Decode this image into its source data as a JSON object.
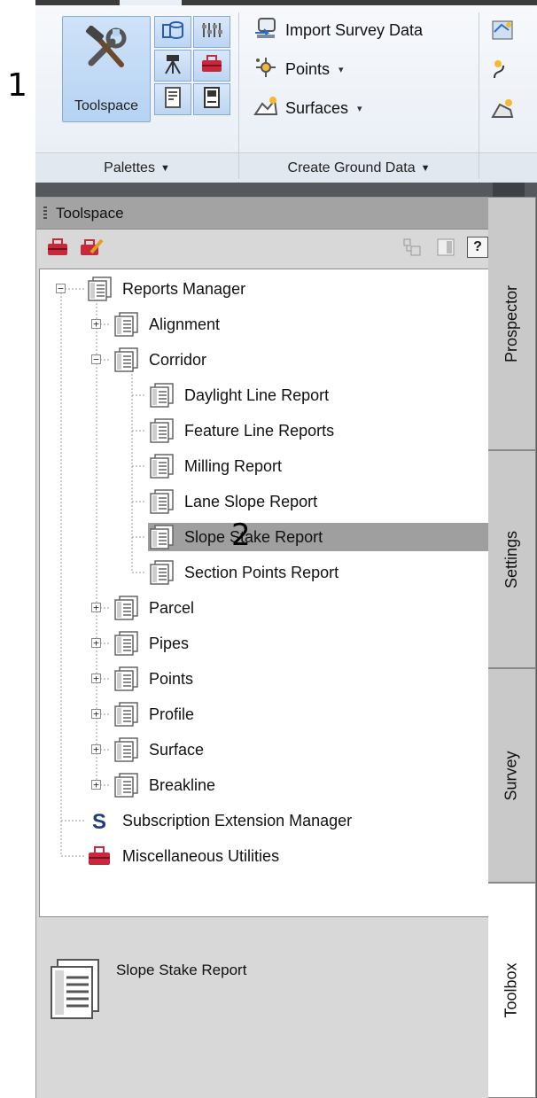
{
  "annotations": {
    "step1": "1",
    "step2": "2"
  },
  "ribbon": {
    "toolspace_button": {
      "label": "Toolspace",
      "icon": "tools-icon"
    },
    "palette_buttons": [
      {
        "icon": "prospector-icon"
      },
      {
        "icon": "settings-icon"
      },
      {
        "icon": "survey-icon"
      },
      {
        "icon": "toolbox-icon"
      },
      {
        "icon": "properties-icon"
      },
      {
        "icon": "command-line-icon"
      }
    ],
    "create_ground_items": [
      {
        "label": "Import Survey Data",
        "icon": "import-survey-icon",
        "dropdown": ""
      },
      {
        "label": "Points",
        "icon": "points-icon",
        "dropdown": "▾"
      },
      {
        "label": "Surfaces",
        "icon": "surfaces-icon",
        "dropdown": "▾"
      }
    ],
    "panels": [
      {
        "label": "Palettes",
        "arrow": "▼"
      },
      {
        "label": "Create Ground Data",
        "arrow": "▼"
      }
    ]
  },
  "toolspace": {
    "title": "Toolspace",
    "toolbar": {
      "help": "?"
    },
    "tree": [
      {
        "label": "Reports Manager",
        "icon": "report-icon",
        "expander": "−"
      },
      {
        "label": "Alignment",
        "icon": "report-icon",
        "expander": "+"
      },
      {
        "label": "Corridor",
        "icon": "report-icon",
        "expander": "−"
      },
      {
        "label": "Daylight Line Report",
        "icon": "report-icon",
        "expander": ""
      },
      {
        "label": "Feature Line Reports",
        "icon": "report-icon",
        "expander": ""
      },
      {
        "label": "Milling Report",
        "icon": "report-icon",
        "expander": ""
      },
      {
        "label": "Lane Slope Report",
        "icon": "report-icon",
        "expander": ""
      },
      {
        "label": "Slope Stake Report",
        "icon": "report-icon",
        "expander": "",
        "selected": true
      },
      {
        "label": "Section Points Report",
        "icon": "report-icon",
        "expander": ""
      },
      {
        "label": "Parcel",
        "icon": "report-icon",
        "expander": "+"
      },
      {
        "label": "Pipes",
        "icon": "report-icon",
        "expander": "+"
      },
      {
        "label": "Points",
        "icon": "report-icon",
        "expander": "+"
      },
      {
        "label": "Profile",
        "icon": "report-icon",
        "expander": "+"
      },
      {
        "label": "Surface",
        "icon": "report-icon",
        "expander": "+"
      },
      {
        "label": "Breakline",
        "icon": "report-icon",
        "expander": "+"
      },
      {
        "label": "Subscription Extension Manager",
        "icon": "subscription-s-icon",
        "expander": ""
      },
      {
        "label": "Miscellaneous Utilities",
        "icon": "toolbox-red-icon",
        "expander": ""
      }
    ],
    "detail": {
      "text": "Slope Stake Report",
      "icon": "report-large-icon"
    },
    "tabs": [
      {
        "label": "Prospector",
        "active": false
      },
      {
        "label": "Settings",
        "active": false
      },
      {
        "label": "Survey",
        "active": false
      },
      {
        "label": "Toolbox",
        "active": true
      }
    ]
  },
  "colors": {
    "selection": "#9f9f9f",
    "ribbon_button": "#b6d3f3",
    "toolbox_red": "#c8283a"
  }
}
